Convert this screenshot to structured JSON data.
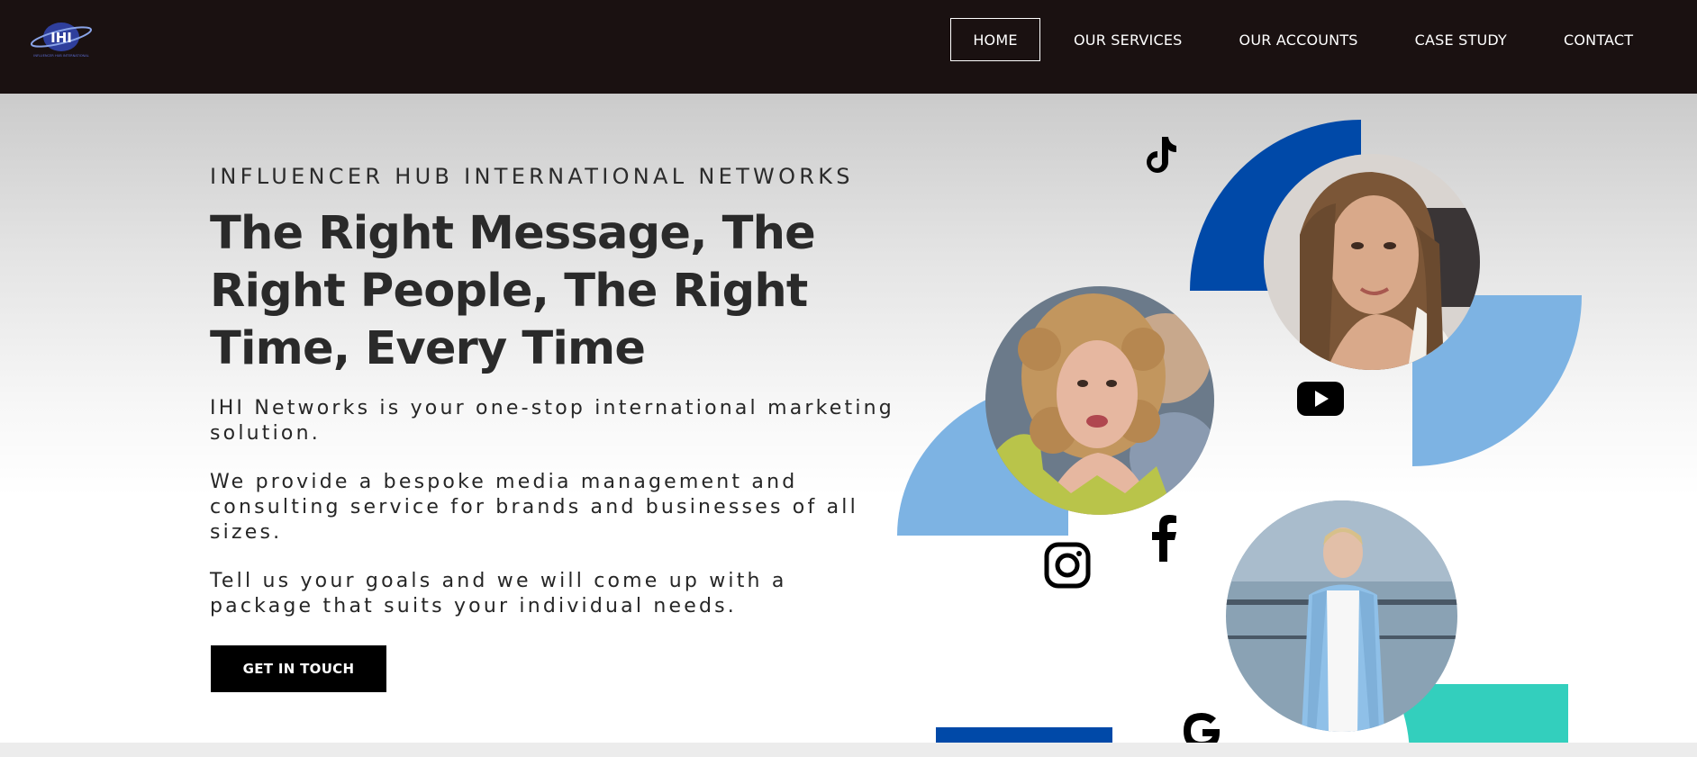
{
  "header": {
    "logo": {
      "text": "IHI",
      "tagline": "INFLUENCER HUB INTERNATIONAL"
    },
    "nav": [
      {
        "label": "HOME",
        "active": true
      },
      {
        "label": "OUR SERVICES",
        "active": false
      },
      {
        "label": "OUR ACCOUNTS",
        "active": false
      },
      {
        "label": "CASE STUDY",
        "active": false
      },
      {
        "label": "CONTACT",
        "active": false
      }
    ]
  },
  "hero": {
    "eyebrow": "INFLUENCER HUB INTERNATIONAL NETWORKS",
    "headline": "The Right Message, The Right People, The Right Time, Every Time",
    "paragraphs": [
      "IHI Networks is your one-stop international marketing solution.",
      "We provide a bespoke media management and consulting service for brands and businesses of all sizes.",
      "Tell us your goals and we will come up with a package that suits your individual needs."
    ],
    "cta_label": "GET IN TOUCH"
  },
  "collage": {
    "icons": [
      "tiktok-icon",
      "youtube-icon",
      "facebook-icon",
      "instagram-icon",
      "google-icon"
    ],
    "colors": {
      "dark_blue": "#0049a8",
      "light_blue": "#7db3e3",
      "teal": "#33cfbd"
    }
  },
  "colors": {
    "header_bg": "#1a1111",
    "cta_bg": "#000000",
    "text": "#2a2a2a"
  }
}
